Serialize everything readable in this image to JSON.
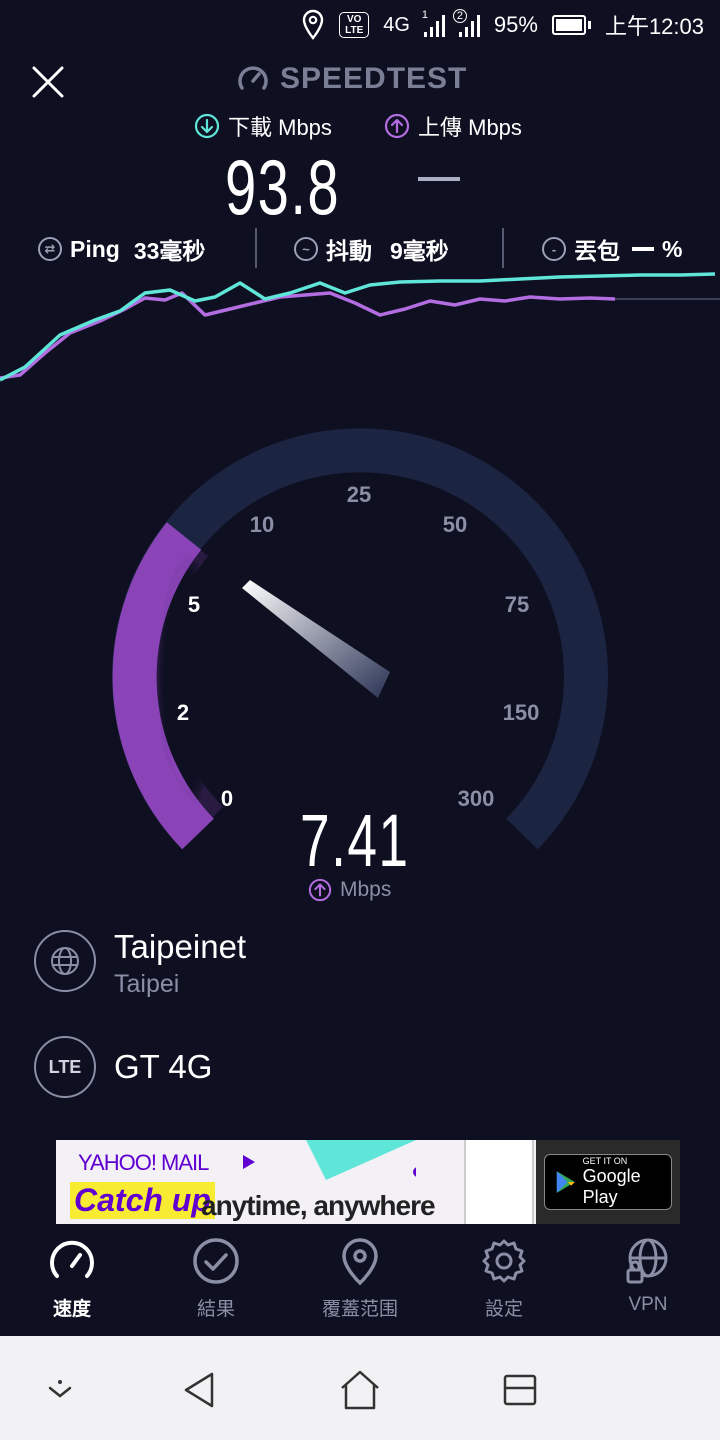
{
  "status_bar": {
    "volte": "VO LTE",
    "network": "4G",
    "sim1": "1",
    "sim2": "2",
    "battery": "95%",
    "time": "上午12:03"
  },
  "header": {
    "brand": "SPEEDTEST"
  },
  "metrics": {
    "download_label": "下載 Mbps",
    "upload_label": "上傳 Mbps",
    "download_value": "93.8"
  },
  "stats": {
    "ping_label": "Ping",
    "ping_value": "33毫秒",
    "jitter_label": "抖動",
    "jitter_value": "9毫秒",
    "loss_label": "丟包",
    "loss_value": "%"
  },
  "gauge": {
    "ticks": [
      "0",
      "2",
      "5",
      "10",
      "25",
      "50",
      "75",
      "150",
      "300"
    ],
    "current_value": "7.41",
    "unit": "Mbps",
    "value_numeric": 7.41
  },
  "server": {
    "name": "Taipeinet",
    "location": "Taipei"
  },
  "network": {
    "badge": "LTE",
    "name": "GT 4G"
  },
  "ad": {
    "brand": "YAHOO! MAIL",
    "headline": "Catch up",
    "tagline": "anytime, anywhere",
    "store_small": "GET IT ON",
    "store_big": "Google Play"
  },
  "tabs": [
    {
      "label": "速度",
      "icon": "speedometer-icon",
      "active": true
    },
    {
      "label": "結果",
      "icon": "checkmark-circle-icon",
      "active": false
    },
    {
      "label": "覆蓋范围",
      "icon": "map-pin-icon",
      "active": false
    },
    {
      "label": "設定",
      "icon": "gear-icon",
      "active": false
    },
    {
      "label": "VPN",
      "icon": "vpn-globe-lock-icon",
      "active": false
    }
  ],
  "colors": {
    "background": "#0f0f22",
    "download_line": "#5fe6d9",
    "upload_line": "#b26de0",
    "gauge_track": "#1b2440",
    "gauge_fill": "#8a44b8",
    "muted_text": "#8a8fa5"
  }
}
